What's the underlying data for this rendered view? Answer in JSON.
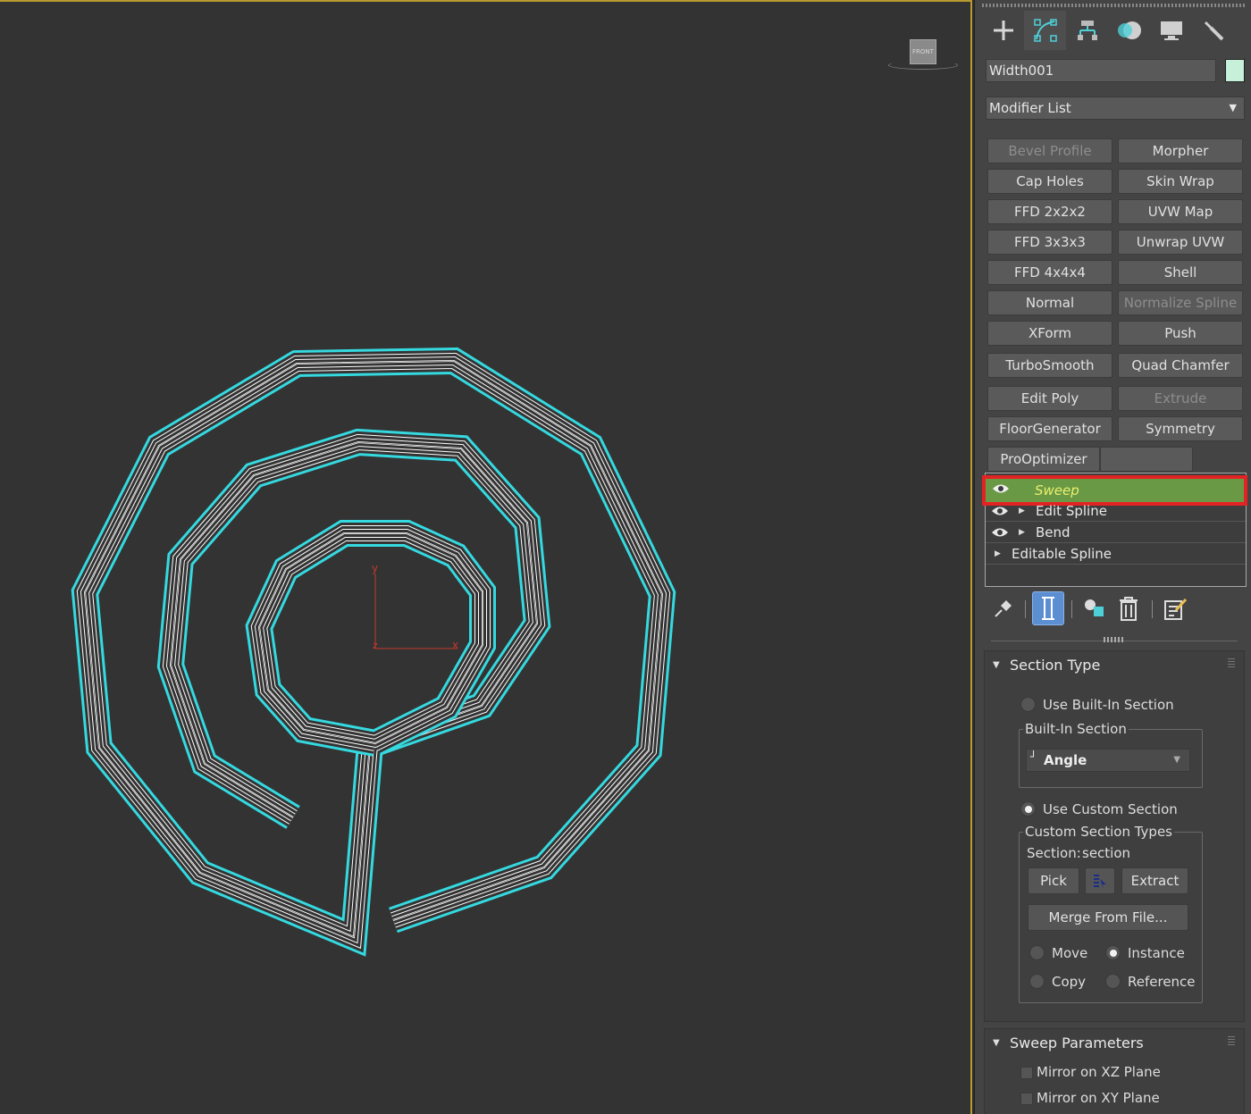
{
  "viewport": {
    "viewcube_label": "FRONT",
    "gizmo": {
      "y_label": "y",
      "x_label": "x",
      "z_label": "z"
    },
    "colors": {
      "spline": "#35d9e0",
      "wire": "#ffffff",
      "background": "#333333",
      "axis": "#c0392b"
    }
  },
  "command_panel": {
    "tabs": [
      "create-icon",
      "modify-icon",
      "hierarchy-icon",
      "motion-icon",
      "display-icon",
      "utilities-icon"
    ],
    "active_tab": "modify-icon",
    "object_name": "Width001",
    "object_color": "#c6f0d9",
    "modifier_list_label": "Modifier List",
    "modifier_buttons": [
      {
        "label": "Bevel Profile",
        "enabled": false
      },
      {
        "label": "Morpher",
        "enabled": true
      },
      {
        "label": "Cap Holes",
        "enabled": true
      },
      {
        "label": "Skin Wrap",
        "enabled": true
      },
      {
        "label": "FFD 2x2x2",
        "enabled": true
      },
      {
        "label": "UVW Map",
        "enabled": true
      },
      {
        "label": "FFD 3x3x3",
        "enabled": true
      },
      {
        "label": "Unwrap UVW",
        "enabled": true
      },
      {
        "label": "FFD 4x4x4",
        "enabled": true
      },
      {
        "label": "Shell",
        "enabled": true
      },
      {
        "label": "Normal",
        "enabled": true
      },
      {
        "label": "Normalize Spline",
        "enabled": false
      },
      {
        "label": "XForm",
        "enabled": true
      },
      {
        "label": "Push",
        "enabled": true
      },
      {
        "label": "TurboSmooth",
        "enabled": true
      },
      {
        "label": "Quad Chamfer",
        "enabled": true
      },
      {
        "label": "Edit Poly",
        "enabled": true
      },
      {
        "label": "Extrude",
        "enabled": false
      },
      {
        "label": "FloorGenerator",
        "enabled": true
      },
      {
        "label": "Symmetry",
        "enabled": true
      },
      {
        "label": "ProOptimizer",
        "enabled": true
      },
      {
        "label": "",
        "enabled": true
      }
    ],
    "stack": [
      {
        "label": "Sweep",
        "selected": true,
        "eye": true,
        "expander": false
      },
      {
        "label": "Edit Spline",
        "selected": false,
        "eye": true,
        "expander": true
      },
      {
        "label": "Bend",
        "selected": false,
        "eye": true,
        "expander": true
      },
      {
        "label": "Editable Spline",
        "selected": false,
        "eye": false,
        "expander": true
      }
    ],
    "stack_toolbar": [
      "pin-stack-icon",
      "show-end-result-icon",
      "make-unique-icon",
      "remove-modifier-icon",
      "configure-modifier-sets-icon"
    ]
  },
  "section_type": {
    "title": "Section Type",
    "use_builtin_label": "Use Built-In Section",
    "builtin_group_label": "Built-In Section",
    "builtin_selected": "Angle",
    "use_custom_label": "Use Custom Section",
    "custom_group_label": "Custom Section Types",
    "section_label": "Section:",
    "section_value": "section",
    "pick_label": "Pick",
    "extract_label": "Extract",
    "merge_label": "Merge From File...",
    "move_label": "Move",
    "instance_label": "Instance",
    "copy_label": "Copy",
    "reference_label": "Reference",
    "selected_mode": "use_custom",
    "selected_copy_mode": "instance"
  },
  "sweep_parameters": {
    "title": "Sweep Parameters",
    "mirror_xz_label": "Mirror on XZ Plane",
    "mirror_xy_label": "Mirror on XY Plane",
    "mirror_xz": false,
    "mirror_xy": false
  }
}
